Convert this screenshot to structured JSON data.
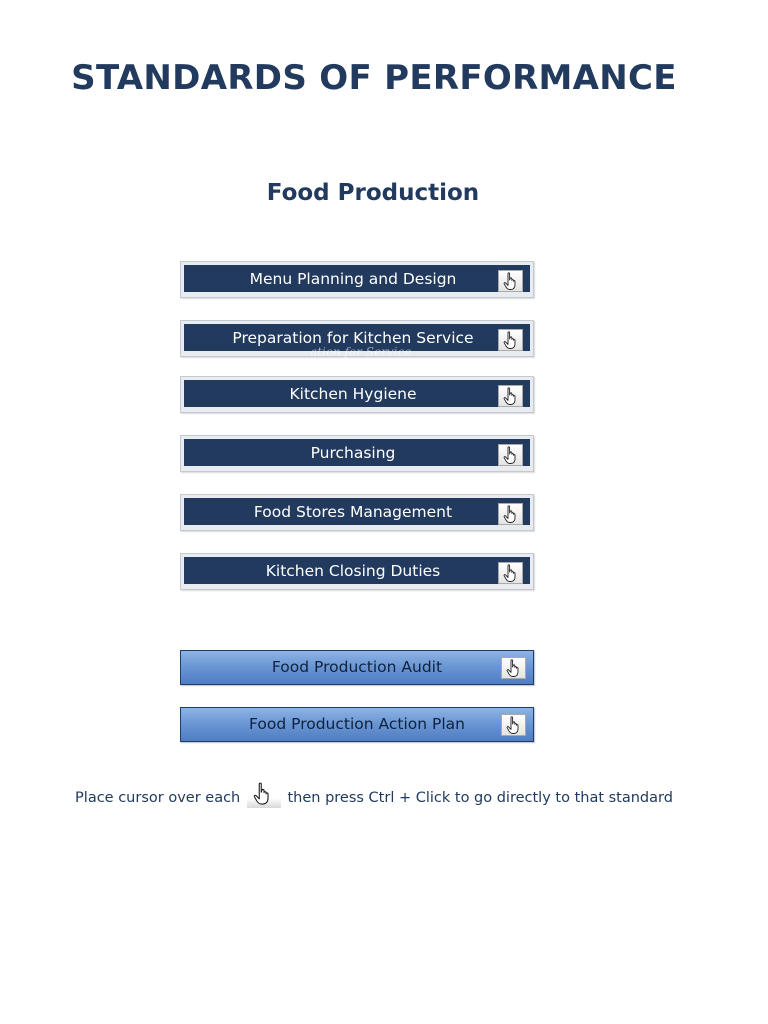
{
  "title": "STANDARDS OF PERFORMANCE",
  "section_title": "Food Production",
  "buttons": [
    {
      "label": "Menu Planning and Design",
      "icon": "hand-pointer-icon"
    },
    {
      "label": "Preparation for Kitchen Service",
      "icon": "hand-pointer-icon"
    },
    {
      "label": "Kitchen Hygiene",
      "icon": "hand-pointer-icon"
    },
    {
      "label": "Purchasing",
      "icon": "hand-pointer-icon"
    },
    {
      "label": "Food Stores Management",
      "icon": "hand-pointer-icon"
    },
    {
      "label": "Kitchen Closing Duties",
      "icon": "hand-pointer-icon"
    }
  ],
  "ghost_text": "ation for Service",
  "audit_buttons": [
    {
      "label": "Food Production Audit",
      "icon": "hand-pointer-icon"
    },
    {
      "label": "Food Production Action Plan",
      "icon": "hand-pointer-icon"
    }
  ],
  "instruction": {
    "before": "Place cursor over each",
    "after": "then press Ctrl + Click to go directly to that standard"
  },
  "colors": {
    "navy": "#213a5e",
    "button_light_top": "#8fb4e6",
    "button_light_bottom": "#4f7dc2"
  }
}
